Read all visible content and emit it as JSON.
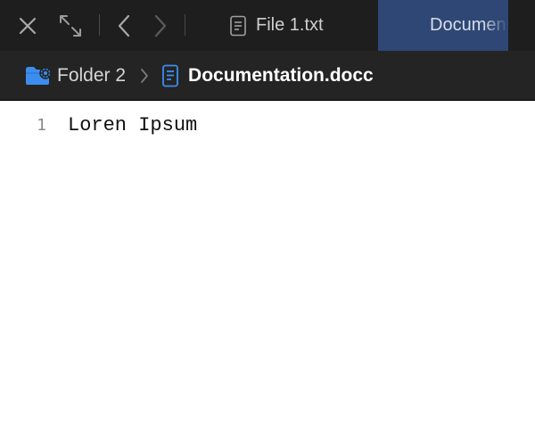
{
  "toolbar": {
    "close_icon": "close-icon",
    "expand_icon": "expand-icon",
    "back_icon": "chevron-left-icon",
    "forward_icon": "chevron-right-icon"
  },
  "tabs": [
    {
      "label": "File 1.txt",
      "icon": "document-icon",
      "active": false
    },
    {
      "label": "Documentation.docc",
      "icon": "document-icon",
      "active": true
    }
  ],
  "breadcrumb": {
    "folder": {
      "label": "Folder 2",
      "icon": "folder-gear-icon"
    },
    "file": {
      "label": "Documentation.docc",
      "icon": "document-icon"
    }
  },
  "editor": {
    "lines": [
      {
        "number": "1",
        "text": "Loren Ipsum"
      }
    ]
  },
  "colors": {
    "tabbar_bg": "#1e1e1e",
    "active_tab_bg": "#2e4775",
    "pathbar_bg": "#242424",
    "accent_blue": "#3b8ef0"
  }
}
